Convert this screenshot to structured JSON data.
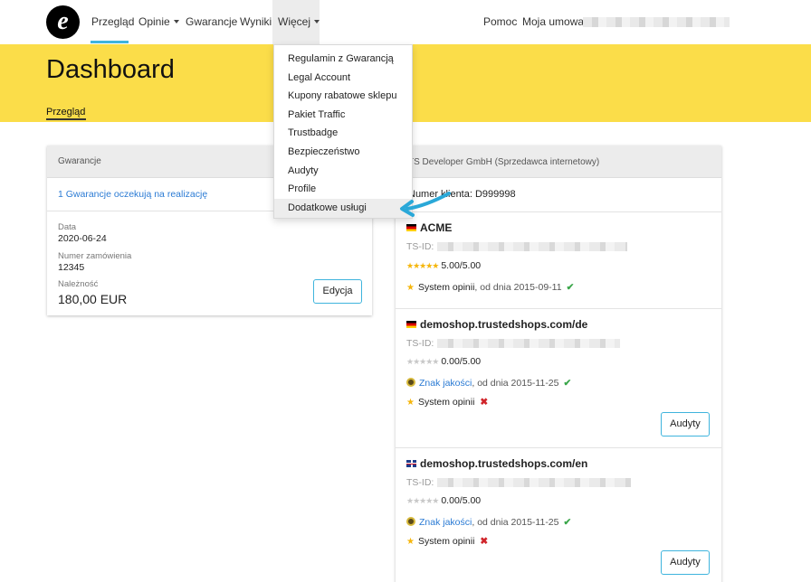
{
  "nav": {
    "logo_letter": "e",
    "items": [
      {
        "label": "Przegląd",
        "caret": false
      },
      {
        "label": "Opinie",
        "caret": true
      },
      {
        "label": "Gwarancje",
        "caret": false
      },
      {
        "label": "Wyniki",
        "caret": false
      },
      {
        "label": "Więcej",
        "caret": true
      }
    ],
    "right_items": [
      "Pomoc",
      "Moja umowa"
    ]
  },
  "page": {
    "title": "Dashboard",
    "subtab": "Przegląd"
  },
  "dropdown": {
    "items": [
      "Regulamin z Gwarancją",
      "Legal Account",
      "Kupony rabatowe sklepu",
      "Pakiet Traffic",
      "Trustbadge",
      "Bezpieczeństwo",
      "Audyty",
      "Profile",
      "Dodatkowe usługi"
    ],
    "highlighted": "Dodatkowe usługi"
  },
  "guarantee_card": {
    "header": "Gwarancje",
    "pending_link": "1 Gwarancje oczekują na realizację",
    "date_label": "Data",
    "date_value": "2020-06-24",
    "order_label": "Numer zamówienia",
    "order_value": "12345",
    "due_label": "Należność",
    "due_value": "180,00 EUR",
    "edit_button": "Edycja"
  },
  "seller_card": {
    "header": "TS Developer GmbH (Sprzedawca internetowy)",
    "client_number": "Numer klienta: D999998",
    "shops": [
      {
        "name": "ACME",
        "flag": "de",
        "tsid_label": "TS-ID:",
        "rating": "5.00/5.00",
        "stars_filled": 5,
        "features": [
          {
            "icon": "star-icon",
            "name": "System opinii",
            "since": ", od dnia 2015-09-11",
            "status": "✔",
            "link": false
          }
        ],
        "button": null
      },
      {
        "name": "demoshop.trustedshops.com/de",
        "flag": "de",
        "tsid_label": "TS-ID:",
        "rating": "0.00/5.00",
        "stars_filled": 0,
        "features": [
          {
            "icon": "seal-icon",
            "name": "Znak jakości",
            "since": ", od dnia 2015-11-25",
            "status": "✔",
            "link": true
          },
          {
            "icon": "star-icon",
            "name": "System opinii",
            "since": "",
            "status": "✖",
            "link": false
          }
        ],
        "button": "Audyty"
      },
      {
        "name": "demoshop.trustedshops.com/en",
        "flag": "uk",
        "tsid_label": "TS-ID:",
        "rating": "0.00/5.00",
        "stars_filled": 0,
        "features": [
          {
            "icon": "seal-icon",
            "name": "Znak jakości",
            "since": ", od dnia 2015-11-25",
            "status": "✔",
            "link": true
          },
          {
            "icon": "star-icon",
            "name": "System opinii",
            "since": "",
            "status": "✖",
            "link": false
          }
        ],
        "button": "Audyty"
      }
    ]
  },
  "colors": {
    "banner": "#fbdd49",
    "accent": "#3fb4dd",
    "link": "#2b7bd4",
    "star": "#f5b60c",
    "ok": "#3aa64a",
    "error": "#d0252b"
  }
}
